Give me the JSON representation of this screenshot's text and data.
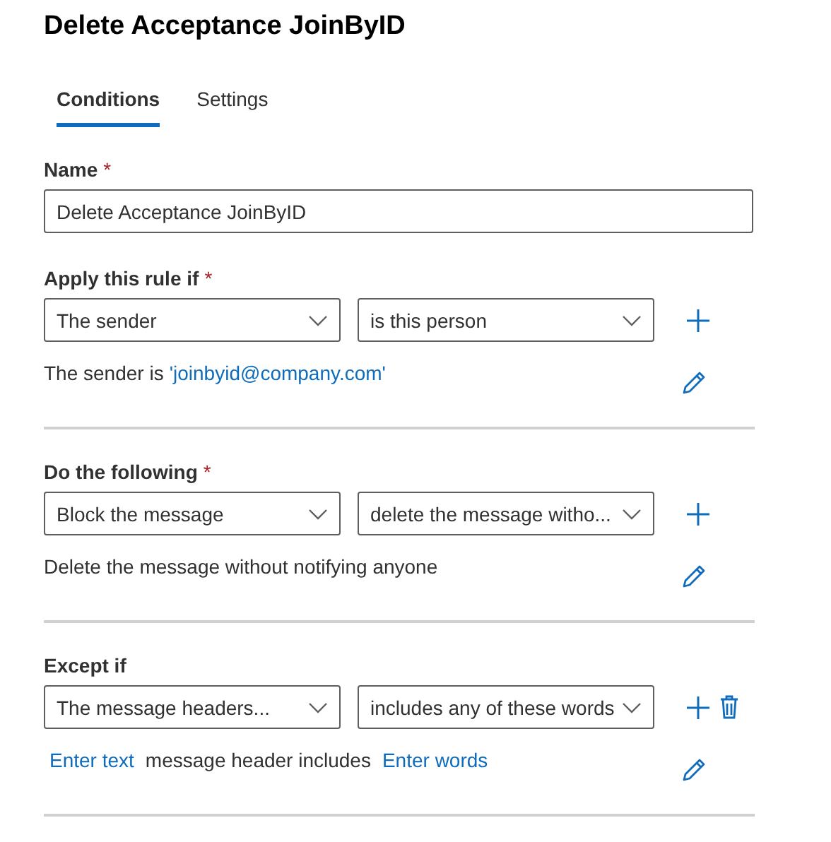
{
  "title": "Delete Acceptance JoinByID",
  "tabs": [
    {
      "label": "Conditions",
      "selected": true
    },
    {
      "label": "Settings",
      "selected": false
    }
  ],
  "name_field": {
    "label": "Name",
    "required_mark": "*",
    "value": "Delete Acceptance JoinByID"
  },
  "sections": [
    {
      "label": "Apply this rule if",
      "required_mark": "*",
      "dropdowns": [
        "The sender",
        "is this person"
      ],
      "actions": [
        {
          "kind": "add"
        }
      ],
      "description": [
        {
          "kind": "text",
          "text": "The sender is"
        },
        {
          "kind": "link",
          "text": "'joinbyid@company.com'"
        }
      ]
    },
    {
      "label": "Do the following",
      "required_mark": "*",
      "dropdowns": [
        "Block the message",
        "delete the message witho..."
      ],
      "actions": [
        {
          "kind": "add"
        }
      ],
      "description": [
        {
          "kind": "text",
          "text": "Delete the message without notifying anyone"
        }
      ]
    },
    {
      "label": "Except if",
      "dropdowns": [
        "The message headers...",
        "includes any of these words"
      ],
      "actions": [
        {
          "kind": "add"
        },
        {
          "kind": "delete"
        }
      ],
      "description": [
        {
          "kind": "link",
          "text": "Enter text"
        },
        {
          "kind": "text",
          "text": "message header includes"
        },
        {
          "kind": "link",
          "text": "Enter words"
        }
      ]
    }
  ]
}
